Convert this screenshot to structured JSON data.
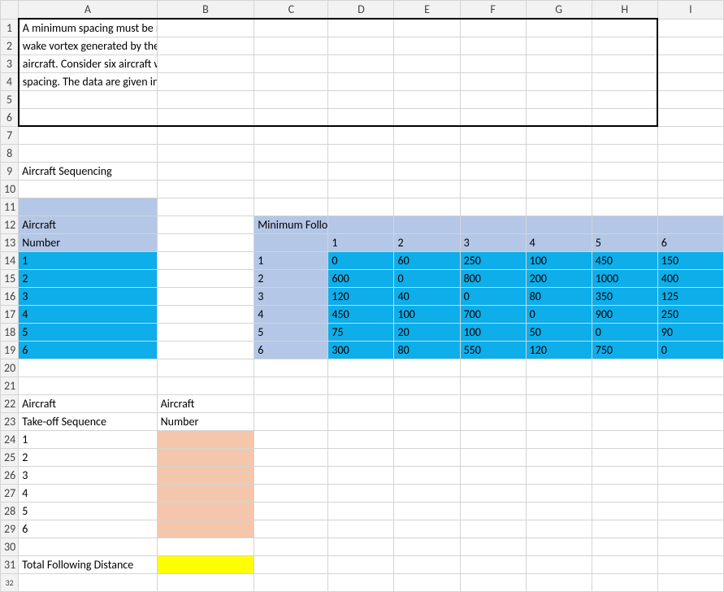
{
  "columns": [
    "A",
    "B",
    "C",
    "D",
    "E",
    "F",
    "G",
    "H",
    "I"
  ],
  "rows": 32,
  "problem": {
    "line1": "A minimum spacing must be maintained when two consecutive aircraft take off from a runway to avoid impact of the",
    "line2": "wake vortex generated by the leading aircraft. The minimum required space depends on the aircraft types of the two",
    "line3": "aircraft. Consider six aircraft waiting to take off and sequence their tale-offs to minimize the total amount of such",
    "line4": "spacing. The data are given in the template entitled"
  },
  "labels": {
    "title": "Aircraft Sequencing",
    "aircraft": "Aircraft",
    "number": "Number",
    "distanceHeader": "Minimum Following Distance (i.e., Spacing) Required for Safety, to Avoid Wake Vortex",
    "takeoffSequence": "Take-off Sequence",
    "totalFollowingDistance": "Total Following Distance"
  },
  "aircraftNumbers": [
    1,
    2,
    3,
    4,
    5,
    6
  ],
  "matrixHeaders": [
    1,
    2,
    3,
    4,
    5,
    6
  ],
  "matrixRowHeaders": [
    1,
    2,
    3,
    4,
    5,
    6
  ],
  "matrix": [
    [
      0,
      60,
      250,
      100,
      450,
      150
    ],
    [
      600,
      0,
      800,
      200,
      1000,
      400
    ],
    [
      120,
      40,
      0,
      80,
      350,
      125
    ],
    [
      450,
      100,
      700,
      0,
      900,
      250
    ],
    [
      75,
      20,
      100,
      50,
      0,
      90
    ],
    [
      300,
      80,
      550,
      120,
      750,
      0
    ]
  ],
  "sequenceNumbers": [
    1,
    2,
    3,
    4,
    5,
    6
  ],
  "sequenceAircraft": [
    "",
    "",
    "",
    "",
    "",
    ""
  ],
  "totalFollowingDistance": "",
  "colors": {
    "headerBlue": "#b4c7e7",
    "dataBlue": "#0daeea",
    "inputOrange": "#f4c7ac",
    "resultYellow": "#ffff00"
  },
  "chart_data": {
    "type": "table",
    "title": "Minimum Following Distance (i.e., Spacing) Required for Safety, to Avoid Wake Vortex",
    "row_labels": [
      1,
      2,
      3,
      4,
      5,
      6
    ],
    "col_labels": [
      1,
      2,
      3,
      4,
      5,
      6
    ],
    "values": [
      [
        0,
        60,
        250,
        100,
        450,
        150
      ],
      [
        600,
        0,
        800,
        200,
        1000,
        400
      ],
      [
        120,
        40,
        0,
        80,
        350,
        125
      ],
      [
        450,
        100,
        700,
        0,
        900,
        250
      ],
      [
        75,
        20,
        100,
        50,
        0,
        90
      ],
      [
        300,
        80,
        550,
        120,
        750,
        0
      ]
    ]
  }
}
